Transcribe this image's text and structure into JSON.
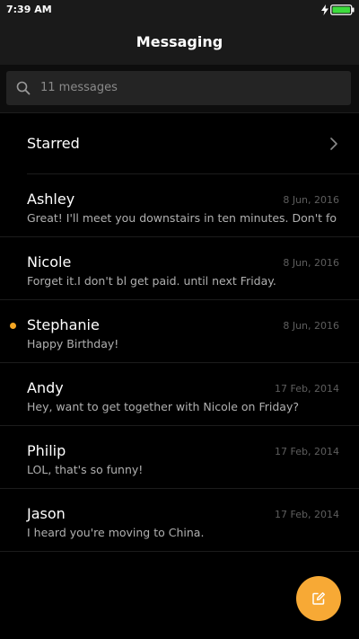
{
  "status_bar": {
    "time": "7:39 AM",
    "battery_color": "#3ddc3d"
  },
  "header": {
    "title": "Messaging"
  },
  "search": {
    "icon": "search-icon",
    "text": "11 messages"
  },
  "starred": {
    "label": "Starred",
    "icon": "chevron-right-icon"
  },
  "messages": [
    {
      "sender": "Ashley",
      "date": "8 Jun, 2016",
      "preview": "Great! I'll meet you downstairs in ten minutes. Don't forge",
      "unread": false
    },
    {
      "sender": "Nicole",
      "date": "8 Jun, 2016",
      "preview": "Forget it.I don't bl get paid. until next Friday.",
      "unread": false
    },
    {
      "sender": "Stephanie",
      "date": "8 Jun, 2016",
      "preview": "Happy Birthday!",
      "unread": true
    },
    {
      "sender": "Andy",
      "date": "17 Feb, 2014",
      "preview": "Hey, want to get together with Nicole on Friday?",
      "unread": false
    },
    {
      "sender": "Philip",
      "date": "17 Feb, 2014",
      "preview": "LOL, that's so funny!",
      "unread": false
    },
    {
      "sender": "Jason",
      "date": "17 Feb, 2014",
      "preview": "I heard you're moving to China.",
      "unread": false
    }
  ],
  "colors": {
    "accent": "#f7a935",
    "unread_dot": "#f5a623"
  },
  "compose": {
    "icon": "compose-icon"
  }
}
